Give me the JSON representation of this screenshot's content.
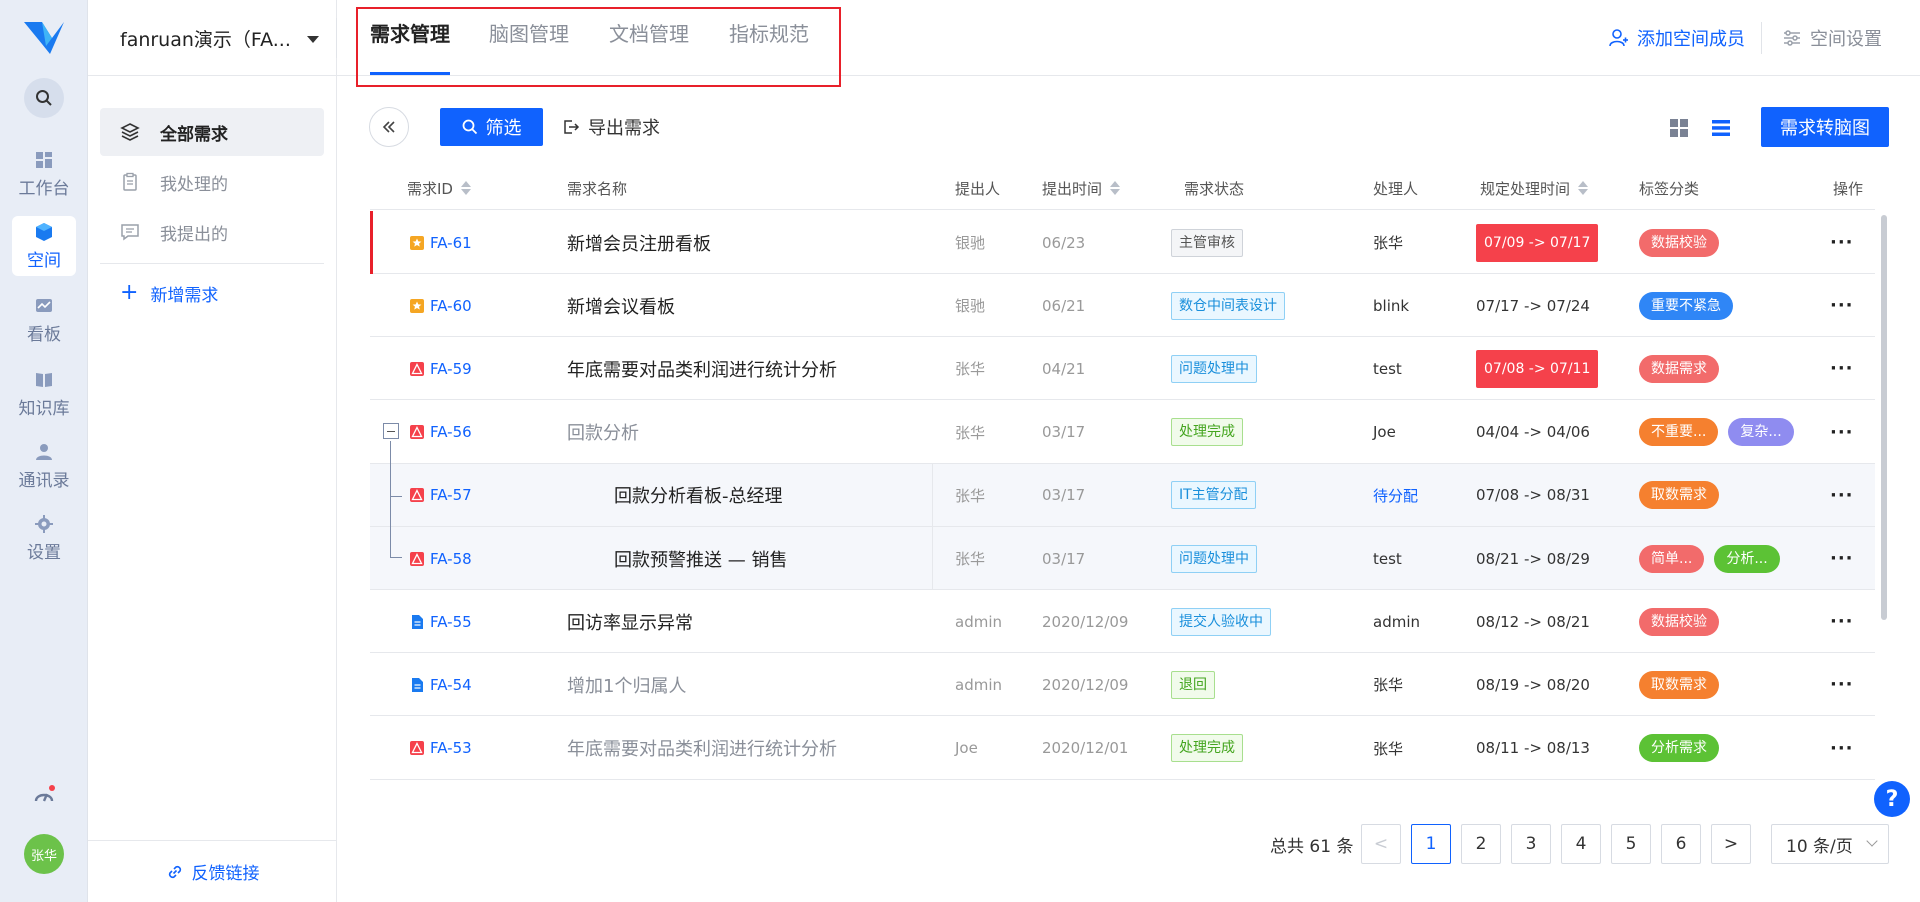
{
  "rail": {
    "items": [
      {
        "label": "工作台"
      },
      {
        "label": "空间"
      },
      {
        "label": "看板"
      },
      {
        "label": "知识库"
      },
      {
        "label": "通讯录"
      },
      {
        "label": "设置"
      }
    ],
    "avatar": "张华",
    "accent": "#1062fe"
  },
  "sidebar": {
    "space_name": "fanruan演示（FA...",
    "items": [
      {
        "label": "全部需求"
      },
      {
        "label": "我处理的"
      },
      {
        "label": "我提出的"
      }
    ],
    "add_label": "新增需求",
    "feedback_label": "反馈链接"
  },
  "header": {
    "tabs": [
      {
        "label": "需求管理"
      },
      {
        "label": "脑图管理"
      },
      {
        "label": "文档管理"
      },
      {
        "label": "指标规范"
      }
    ],
    "add_member": "添加空间成员",
    "space_settings": "空间设置"
  },
  "toolbar": {
    "filter": "筛选",
    "export": "导出需求",
    "to_mind": "需求转脑图"
  },
  "table": {
    "headers": {
      "id": "需求ID",
      "name": "需求名称",
      "submitter": "提出人",
      "time": "提出时间",
      "status": "需求状态",
      "handler": "处理人",
      "deadline": "规定处理时间",
      "tags": "标签分类",
      "ops": "操作"
    },
    "rows": [
      {
        "id": "FA-61",
        "icon": "star-icon",
        "name": "新增会员注册看板",
        "submitter": "银驰",
        "time": "06/23",
        "status": "主管审核",
        "handler": "张华",
        "deadline": "07/09 -> 07/17",
        "tags": [
          "数据校验"
        ],
        "ops": "···"
      },
      {
        "id": "FA-60",
        "icon": "star-icon",
        "name": "新增会议看板",
        "submitter": "银驰",
        "time": "06/21",
        "status": "数仓中间表设计",
        "handler": "blink",
        "deadline": "07/17 -> 07/24",
        "tags": [
          "重要不紧急"
        ],
        "ops": "···"
      },
      {
        "id": "FA-59",
        "icon": "alert-icon",
        "name": "年底需要对品类利润进行统计分析",
        "submitter": "张华",
        "time": "04/21",
        "status": "问题处理中",
        "handler": "test",
        "deadline": "07/08 -> 07/11",
        "tags": [
          "数据需求"
        ],
        "ops": "···"
      },
      {
        "id": "FA-56",
        "icon": "alert-icon",
        "name": "回款分析",
        "submitter": "张华",
        "time": "03/17",
        "status": "处理完成",
        "handler": "Joe",
        "deadline": "04/04 -> 04/06",
        "tags": [
          "不重要...",
          "复杂..."
        ],
        "ops": "···"
      },
      {
        "id": "FA-57",
        "icon": "alert-icon",
        "name": "回款分析看板-总经理",
        "submitter": "张华",
        "time": "03/17",
        "status": "IT主管分配",
        "handler": "待分配",
        "deadline": "07/08 -> 08/31",
        "tags": [
          "取数需求"
        ],
        "ops": "···"
      },
      {
        "id": "FA-58",
        "icon": "alert-icon",
        "name": "回款预警推送 — 销售",
        "submitter": "张华",
        "time": "03/17",
        "status": "问题处理中",
        "handler": "test",
        "deadline": "08/21 -> 08/29",
        "tags": [
          "简单...",
          "分析..."
        ],
        "ops": "···"
      },
      {
        "id": "FA-55",
        "icon": "doc-icon",
        "name": "回访率显示异常",
        "submitter": "admin",
        "time": "2020/12/09",
        "status": "提交人验收中",
        "handler": "admin",
        "deadline": "08/12 -> 08/21",
        "tags": [
          "数据校验"
        ],
        "ops": "···"
      },
      {
        "id": "FA-54",
        "icon": "doc-icon",
        "name": "增加1个归属人",
        "submitter": "admin",
        "time": "2020/12/09",
        "status": "退回",
        "handler": "张华",
        "deadline": "08/19 -> 08/20",
        "tags": [
          "取数需求"
        ],
        "ops": "···"
      },
      {
        "id": "FA-53",
        "icon": "alert-icon",
        "name": "年底需要对品类利润进行统计分析",
        "submitter": "Joe",
        "time": "2020/12/01",
        "status": "处理完成",
        "handler": "张华",
        "deadline": "08/11 -> 08/13",
        "tags": [
          "分析需求"
        ],
        "ops": "···"
      }
    ],
    "tag_colors": {
      "数据校验": "#f26b6b",
      "重要不紧急": "#2f86f6",
      "数据需求": "#f26b6b",
      "不重要...": "#f5802f",
      "复杂...": "#8f8cf0",
      "取数需求": "#f5802f",
      "简单...": "#f26b6b",
      "分析...": "#5cc235",
      "分析需求": "#5cc235"
    }
  },
  "pagination": {
    "total": "总共 61 条",
    "prev": "<",
    "pages": [
      "1",
      "2",
      "3",
      "4",
      "5",
      "6"
    ],
    "next": ">",
    "page_size": "10 条/页"
  },
  "help": "?"
}
